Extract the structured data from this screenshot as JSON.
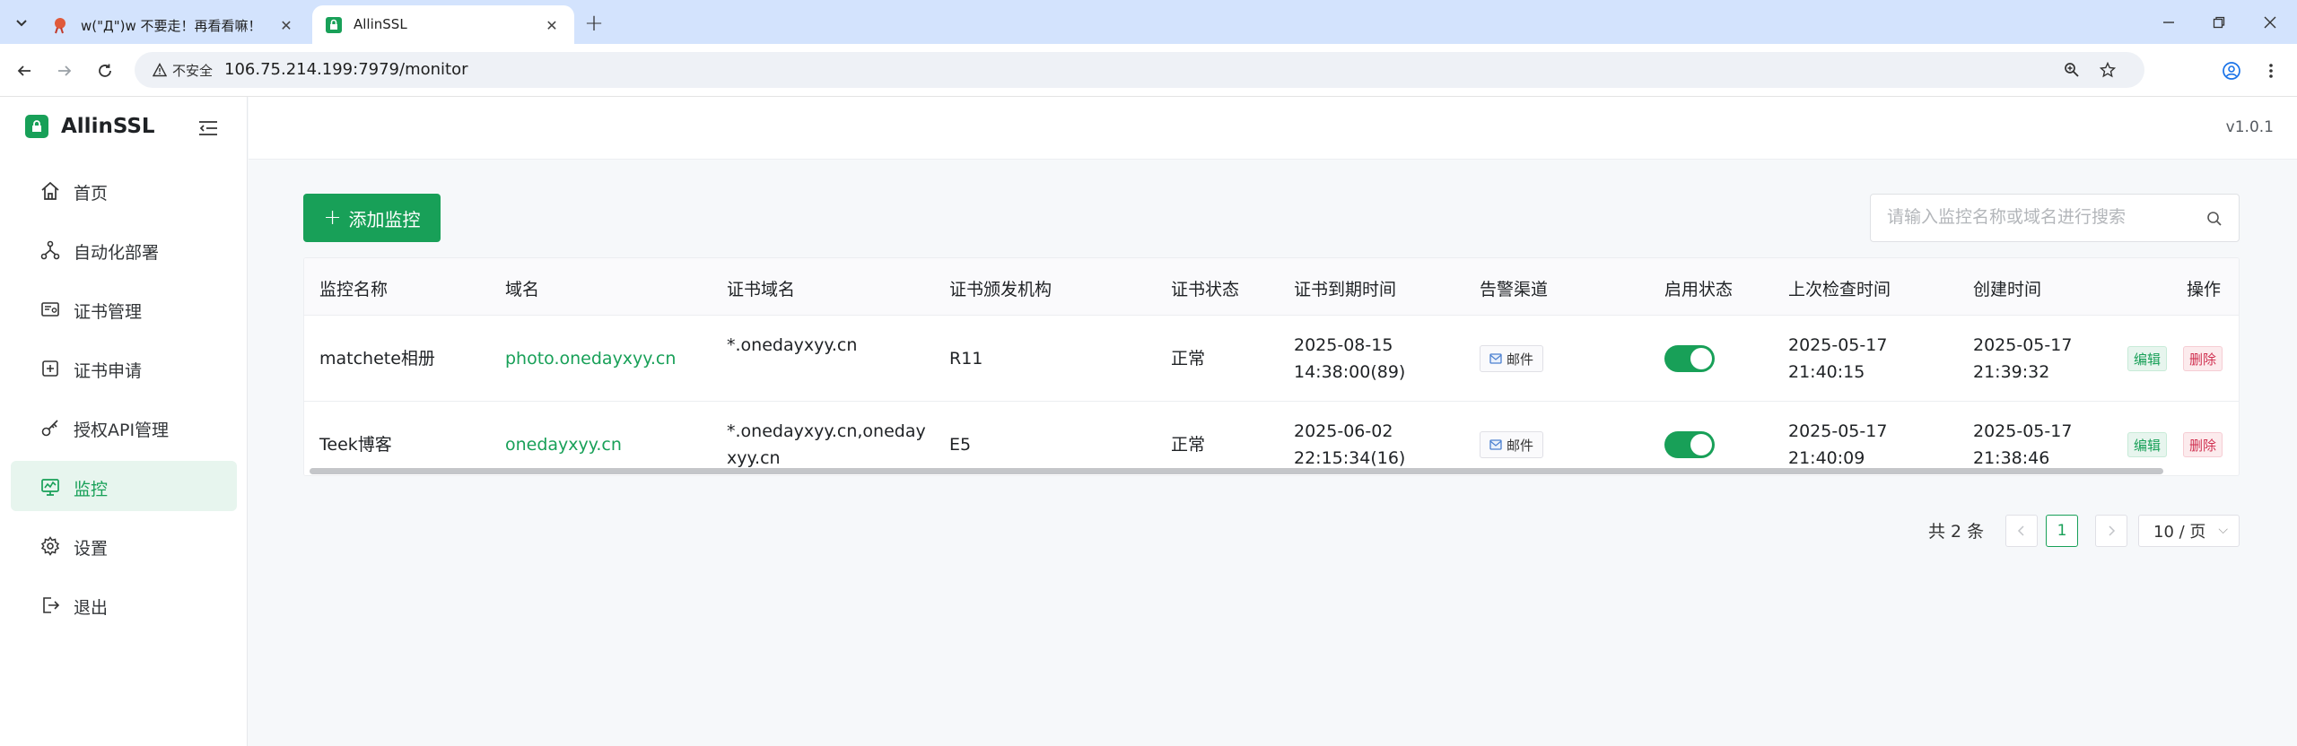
{
  "browser": {
    "tabs": [
      {
        "title": "w(\"Д\")w 不要走！再看看嘛！",
        "active": false
      },
      {
        "title": "AllinSSL",
        "active": true
      }
    ],
    "security_label": "不安全",
    "url": "106.75.214.199:7979/monitor"
  },
  "app": {
    "brand": "AllinSSL",
    "version": "v1.0.1",
    "menu": [
      {
        "label": "首页",
        "icon": "home-icon",
        "active": false
      },
      {
        "label": "自动化部署",
        "icon": "workflow-icon",
        "active": false
      },
      {
        "label": "证书管理",
        "icon": "certificate-icon",
        "active": false
      },
      {
        "label": "证书申请",
        "icon": "plus-square-icon",
        "active": false
      },
      {
        "label": "授权API管理",
        "icon": "key-icon",
        "active": false
      },
      {
        "label": "监控",
        "icon": "monitor-icon",
        "active": true
      },
      {
        "label": "设置",
        "icon": "gear-icon",
        "active": false
      },
      {
        "label": "退出",
        "icon": "logout-icon",
        "active": false
      }
    ]
  },
  "toolbar": {
    "add_label": "添加监控",
    "search_placeholder": "请输入监控名称或域名进行搜索"
  },
  "table": {
    "columns": [
      "监控名称",
      "域名",
      "证书域名",
      "证书颁发机构",
      "证书状态",
      "证书到期时间",
      "告警渠道",
      "启用状态",
      "上次检查时间",
      "创建时间",
      "操作"
    ],
    "rows": [
      {
        "name": "matchete相册",
        "domain": "photo.onedayxyy.cn",
        "cert_domain_1": "*.onedayxyy.cn",
        "cert_domain_2": "",
        "issuer": "R11",
        "status": "正常",
        "expire_date": "2025-08-15",
        "expire_time": "14:38:00(89)",
        "channel": "邮件",
        "enabled": true,
        "last_check_date": "2025-05-17",
        "last_check_time": "21:40:15",
        "created_date": "2025-05-17",
        "created_time": "21:39:32",
        "edit_label": "编辑",
        "delete_label": "删除"
      },
      {
        "name": "Teek博客",
        "domain": "onedayxyy.cn",
        "cert_domain_1": "*.onedayxyy.cn,oneday",
        "cert_domain_2": "xyy.cn",
        "issuer": "E5",
        "status": "正常",
        "expire_date": "2025-06-02",
        "expire_time": "22:15:34(16)",
        "channel": "邮件",
        "enabled": true,
        "last_check_date": "2025-05-17",
        "last_check_time": "21:40:09",
        "created_date": "2025-05-17",
        "created_time": "21:38:46",
        "edit_label": "编辑",
        "delete_label": "删除"
      }
    ]
  },
  "pagination": {
    "total_label": "共 2 条",
    "current_page": "1",
    "page_size_label": "10 / 页"
  },
  "colors": {
    "brand_green": "#18a058",
    "danger_red": "#d03050"
  }
}
